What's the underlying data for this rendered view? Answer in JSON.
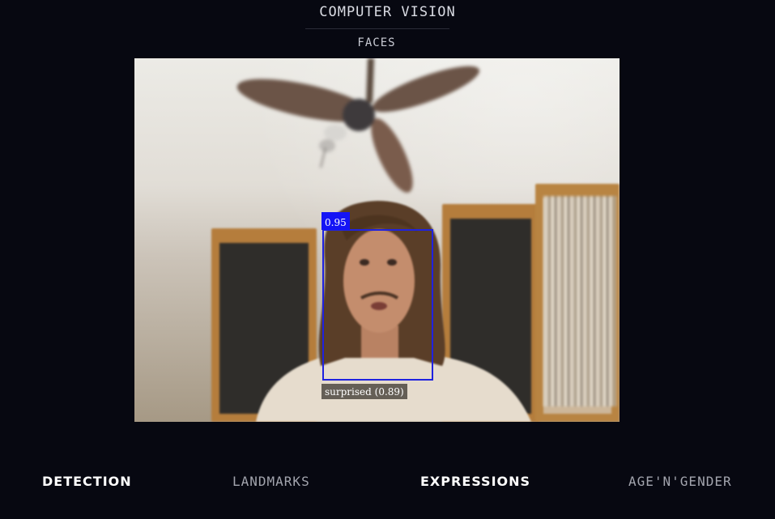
{
  "header": {
    "title": "COMPUTER VISION",
    "section": "FACES"
  },
  "detection": {
    "score": "0.95",
    "expression": "surprised (0.89)"
  },
  "nav": {
    "items": [
      {
        "label": "DETECTION",
        "active": true
      },
      {
        "label": "LANDMARKS",
        "active": false
      },
      {
        "label": "EXPRESSIONS",
        "active": true
      },
      {
        "label": "AGE'N'GENDER",
        "active": false
      }
    ]
  },
  "colors": {
    "background": "#070811",
    "box": "#1f22e0",
    "score_label_bg": "#1414f5"
  }
}
